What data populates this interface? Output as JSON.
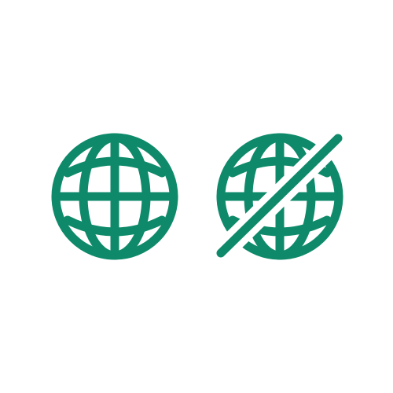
{
  "colors": {
    "icon": "#0e8a6a",
    "background": "#ffffff"
  },
  "icons": [
    {
      "name": "globe-icon"
    },
    {
      "name": "globe-off-icon"
    }
  ]
}
